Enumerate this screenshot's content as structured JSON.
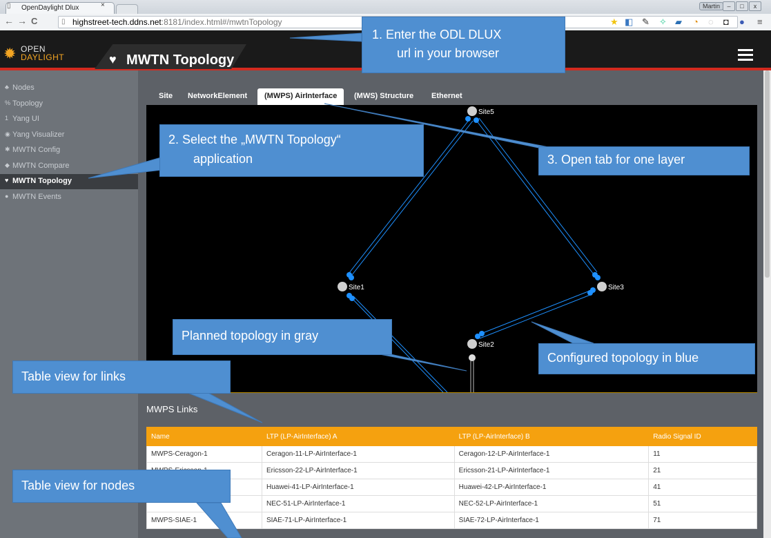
{
  "browser": {
    "tab_title": "OpenDaylight Dlux",
    "tab_close": "×",
    "user": "Martin",
    "url_host": "highstreet-tech.ddns.net",
    "url_rest": ":8181/index.html#/mwtnTopology",
    "back": "←",
    "forward": "→",
    "reload": "C"
  },
  "app": {
    "logo_line1": "OPEN",
    "logo_line2": "DAYLIGHT",
    "title": "MWTN Topology"
  },
  "sidebar": {
    "items": [
      {
        "label": "Nodes",
        "icon": "nodes-icon",
        "glyph": "♣"
      },
      {
        "label": "Topology",
        "icon": "topology-icon",
        "glyph": "%"
      },
      {
        "label": "Yang UI",
        "icon": "yang-ui-icon",
        "glyph": "1"
      },
      {
        "label": "Yang Visualizer",
        "icon": "eye-icon",
        "glyph": "◉"
      },
      {
        "label": "MWTN Config",
        "icon": "gear-icon",
        "glyph": "✱"
      },
      {
        "label": "MWTN Compare",
        "icon": "compare-icon",
        "glyph": "◆"
      },
      {
        "label": "MWTN Topology",
        "icon": "heart-icon",
        "glyph": "♥",
        "active": true
      },
      {
        "label": "MWTN Events",
        "icon": "comments-icon",
        "glyph": "●"
      }
    ]
  },
  "tabs": [
    "Site",
    "NetworkElement",
    "(MWPS) AirInterface",
    "(MWS) Structure",
    "Ethernet"
  ],
  "active_tab": "(MWPS) AirInterface",
  "topology": {
    "sites": [
      "Site5",
      "Site1",
      "Site3",
      "Site2"
    ],
    "configured_color": "#1e90ff",
    "planned_color": "#9e9e9e"
  },
  "links_table": {
    "title": "MWPS Links",
    "columns": [
      "Name",
      "LTP (LP-AirInterface) A",
      "LTP (LP-AirInterface) B",
      "Radio Signal ID"
    ],
    "rows": [
      [
        "MWPS-Ceragon-1",
        "Ceragon-11-LP-AirInterface-1",
        "Ceragon-12-LP-AirInterface-1",
        "11"
      ],
      [
        "MWPS-Ericsson-1",
        "Ericsson-22-LP-AirInterface-1",
        "Ericsson-21-LP-AirInterface-1",
        "21"
      ],
      [
        "",
        "Huawei-41-LP-AirInterface-1",
        "Huawei-42-LP-AirInterface-1",
        "41"
      ],
      [
        "",
        "NEC-51-LP-AirInterface-1",
        "NEC-52-LP-AirInterface-1",
        "51"
      ],
      [
        "MWPS-SIAE-1",
        "SIAE-71-LP-AirInterface-1",
        "SIAE-72-LP-AirInterface-1",
        "71"
      ]
    ]
  },
  "callouts": {
    "c1_line1": "1.  Enter the ODL DLUX",
    "c1_line2": "url in your browser",
    "c2_line1": "2.  Select the „MWTN Topology“",
    "c2_line2": "application",
    "c3": "3.  Open tab for one layer",
    "planned": "Planned topology in gray",
    "configured": "Configured topology in blue",
    "links": "Table view for links",
    "nodes": "Table view for nodes"
  },
  "colors": {
    "header_accent": "#d32a1f",
    "table_header": "#f5a10f",
    "callout": "#4f8fd1"
  }
}
